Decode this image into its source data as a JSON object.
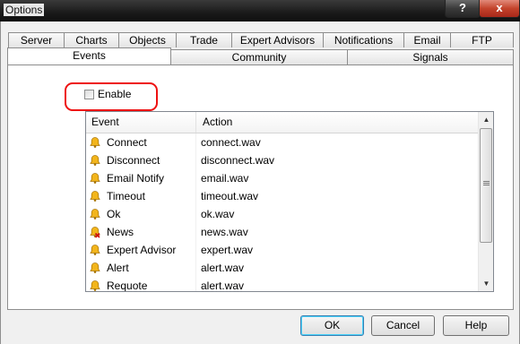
{
  "window": {
    "title": "Options",
    "help_label": "?",
    "close_label": "x"
  },
  "tabs_row1": [
    "Server",
    "Charts",
    "Objects",
    "Trade",
    "Expert Advisors",
    "Notifications",
    "Email",
    "FTP"
  ],
  "tabs_row2": [
    "Events",
    "Community",
    "Signals"
  ],
  "active_tab": "Events",
  "events": {
    "enable_label": "Enable",
    "enable_checked": false,
    "columns": {
      "event": "Event",
      "action": "Action"
    },
    "rows": [
      {
        "event": "Connect",
        "action": "connect.wav",
        "icon": "bell-icon"
      },
      {
        "event": "Disconnect",
        "action": "disconnect.wav",
        "icon": "bell-icon"
      },
      {
        "event": "Email Notify",
        "action": "email.wav",
        "icon": "bell-icon"
      },
      {
        "event": "Timeout",
        "action": "timeout.wav",
        "icon": "bell-icon"
      },
      {
        "event": "Ok",
        "action": "ok.wav",
        "icon": "bell-icon"
      },
      {
        "event": "News",
        "action": "news.wav",
        "icon": "bell-disabled-icon"
      },
      {
        "event": "Expert Advisor",
        "action": "expert.wav",
        "icon": "bell-icon"
      },
      {
        "event": "Alert",
        "action": "alert.wav",
        "icon": "bell-icon"
      },
      {
        "event": "Requote",
        "action": "alert.wav",
        "icon": "bell-icon"
      }
    ]
  },
  "buttons": {
    "ok": "OK",
    "cancel": "Cancel",
    "help": "Help"
  },
  "colors": {
    "highlight": "#ee1111",
    "bell": "#f2b51c"
  }
}
